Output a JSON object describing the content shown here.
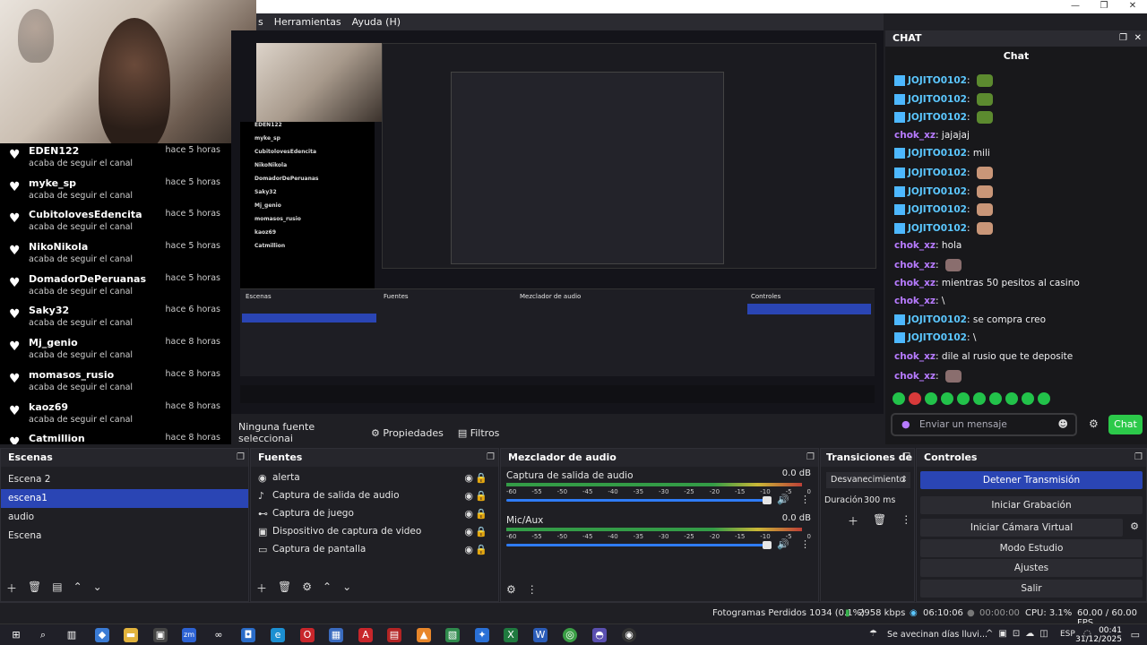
{
  "menubar": {
    "items": [
      "s",
      "Herramientas",
      "Ayuda (H)"
    ]
  },
  "followers": [
    {
      "name": "EDEN122",
      "action": "acaba de seguir el canal",
      "time": "hace 5 horas"
    },
    {
      "name": "myke_sp",
      "action": "acaba de seguir el canal",
      "time": "hace 5 horas"
    },
    {
      "name": "CubitolovesEdencita",
      "action": "acaba de seguir el canal",
      "time": "hace 5 horas"
    },
    {
      "name": "NikoNikola",
      "action": "acaba de seguir el canal",
      "time": "hace 5 horas"
    },
    {
      "name": "DomadorDePeruanas",
      "action": "acaba de seguir el canal",
      "time": "hace 5 horas"
    },
    {
      "name": "Saky32",
      "action": "acaba de seguir el canal",
      "time": "hace 6 horas"
    },
    {
      "name": "Mj_genio",
      "action": "acaba de seguir el canal",
      "time": "hace 8 horas"
    },
    {
      "name": "momasos_rusio",
      "action": "acaba de seguir el canal",
      "time": "hace 8 horas"
    },
    {
      "name": "kaoz69",
      "action": "acaba de seguir el canal",
      "time": "hace 8 horas"
    },
    {
      "name": "Catmillion",
      "action": "",
      "time": "hace 8 horas"
    }
  ],
  "chat": {
    "dock_title": "CHAT",
    "title": "Chat",
    "messages": [
      {
        "user": "JOJITO0102",
        "color": "blue",
        "badge": true,
        "text": "",
        "emote": "#5c8a2f"
      },
      {
        "user": "JOJITO0102",
        "color": "blue",
        "badge": true,
        "text": "",
        "emote": "#5c8a2f"
      },
      {
        "user": "JOJITO0102",
        "color": "blue",
        "badge": true,
        "text": "",
        "emote": "#5c8a2f"
      },
      {
        "user": "chok_xz",
        "color": "purple",
        "badge": false,
        "text": "jajajaj",
        "emote": ""
      },
      {
        "user": "JOJITO0102",
        "color": "blue",
        "badge": true,
        "text": "mili",
        "emote": ""
      },
      {
        "user": "JOJITO0102",
        "color": "blue",
        "badge": true,
        "text": "",
        "emote": "#c99678"
      },
      {
        "user": "JOJITO0102",
        "color": "blue",
        "badge": true,
        "text": "",
        "emote": "#c99678"
      },
      {
        "user": "JOJITO0102",
        "color": "blue",
        "badge": true,
        "text": "",
        "emote": "#c99678"
      },
      {
        "user": "JOJITO0102",
        "color": "blue",
        "badge": true,
        "text": "",
        "emote": "#c99678"
      },
      {
        "user": "chok_xz",
        "color": "purple",
        "badge": false,
        "text": "hola",
        "emote": ""
      },
      {
        "user": "chok_xz",
        "color": "purple",
        "badge": false,
        "text": "",
        "emote": "#8a6e6e"
      },
      {
        "user": "chok_xz",
        "color": "purple",
        "badge": false,
        "text": "mientras 50 pesitos al casino",
        "emote": ""
      },
      {
        "user": "chok_xz",
        "color": "purple",
        "badge": false,
        "text": "\\",
        "emote": ""
      },
      {
        "user": "JOJITO0102",
        "color": "blue",
        "badge": true,
        "text": "se compra creo",
        "emote": ""
      },
      {
        "user": "JOJITO0102",
        "color": "blue",
        "badge": true,
        "text": "\\",
        "emote": ""
      },
      {
        "user": "chok_xz",
        "color": "purple",
        "badge": false,
        "text": "dile al rusio que te deposite",
        "emote": ""
      },
      {
        "user": "chok_xz",
        "color": "purple",
        "badge": false,
        "text": "",
        "emote": "#8a6e6e"
      }
    ],
    "input_placeholder": "Enviar un mensaje",
    "send_label": "Chat"
  },
  "props": {
    "selection": "Ninguna fuente seleccionai",
    "properties": "Propiedades",
    "filters": "Filtros"
  },
  "docks": {
    "scenes": {
      "title": "Escenas",
      "items": [
        "Escena 2",
        "escena1",
        "audio",
        "Escena"
      ],
      "selected": 1
    },
    "sources": {
      "title": "Fuentes",
      "items": [
        {
          "icon": "alert-icon",
          "glyph": "◉",
          "name": "alerta"
        },
        {
          "icon": "speaker-icon",
          "glyph": "♪",
          "name": "Captura de salida de audio"
        },
        {
          "icon": "gamepad-icon",
          "glyph": "⊷",
          "name": "Captura de juego"
        },
        {
          "icon": "camera-icon",
          "glyph": "▣",
          "name": "Dispositivo de captura de video"
        },
        {
          "icon": "monitor-icon",
          "glyph": "▭",
          "name": "Captura de pantalla"
        }
      ]
    },
    "mixer": {
      "title": "Mezclador de audio",
      "tracks": [
        {
          "name": "Captura de salida de audio",
          "db": "0.0 dB"
        },
        {
          "name": "Mic/Aux",
          "db": "0.0 dB"
        }
      ],
      "ticks": [
        "-60",
        "-55",
        "-50",
        "-45",
        "-40",
        "-35",
        "-30",
        "-25",
        "-20",
        "-15",
        "-10",
        "-5",
        "0"
      ]
    },
    "transitions": {
      "title": "Transiciones de ...",
      "type": "Desvanecimiento",
      "duration_label": "Duración",
      "duration_value": "300 ms"
    },
    "controls": {
      "title": "Controles",
      "buttons": [
        "Detener Transmisión",
        "Iniciar Grabación",
        "Iniciar Cámara Virtual",
        "Modo Estudio",
        "Ajustes",
        "Salir"
      ]
    }
  },
  "status": {
    "dropped": "Fotogramas Perdidos 1034 (0.1%)",
    "bitrate": "2958 kbps",
    "live_time": "06:10:06",
    "rec_time": "00:00:00",
    "cpu": "CPU: 3.1%",
    "fps": "60.00 / 60.00 FPS"
  },
  "taskbar": {
    "weather": "Se avecinan días lluvi...",
    "lang": "ESP",
    "time": "00:41",
    "date": "31/12/2025"
  },
  "colors": {
    "accent": "#2a45b4",
    "chat_send": "#2cc94a",
    "twitch_badge": "#4db8ff"
  }
}
